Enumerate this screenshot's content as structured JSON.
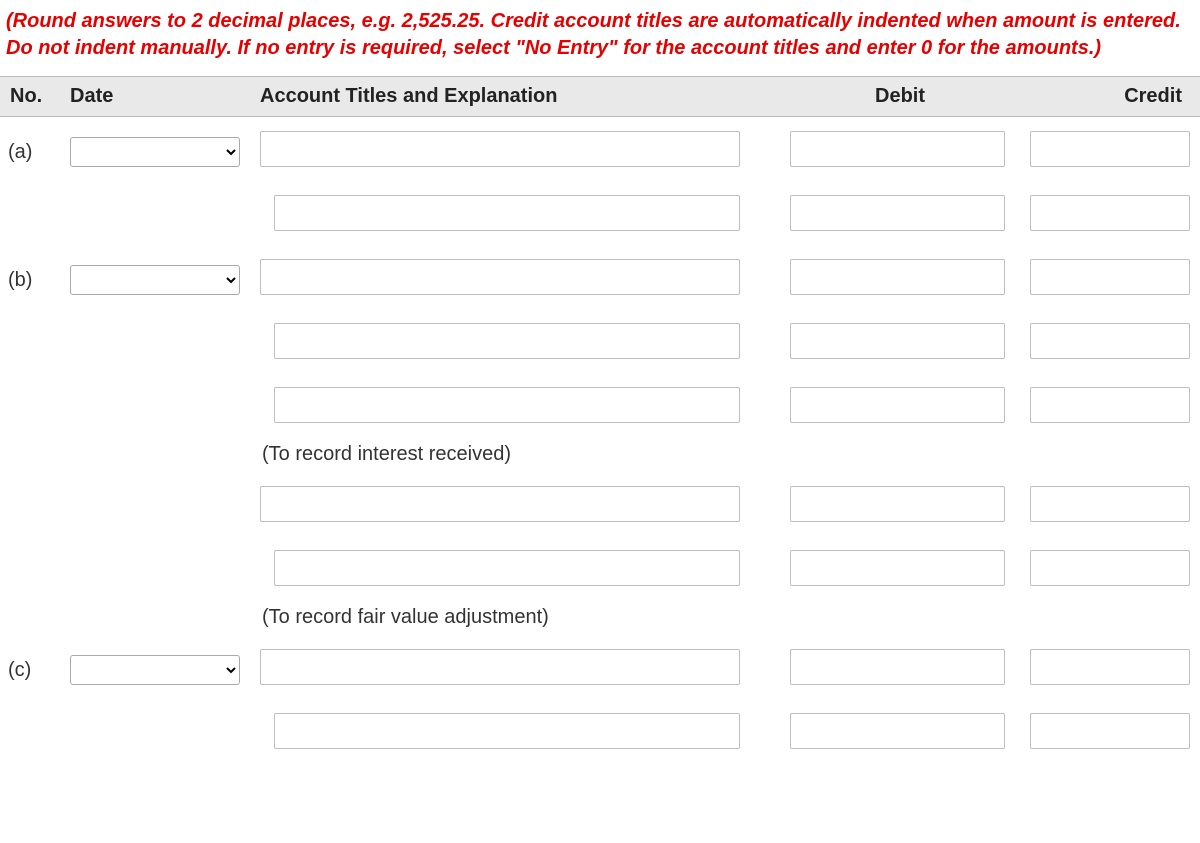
{
  "instructions": "(Round answers to 2 decimal places, e.g. 2,525.25. Credit account titles are automatically indented when amount is entered. Do not indent manually. If no entry is required, select \"No Entry\" for the account titles and enter 0 for the amounts.)",
  "headers": {
    "no": "No.",
    "date": "Date",
    "account": "Account Titles and Explanation",
    "debit": "Debit",
    "credit": "Credit"
  },
  "rows": {
    "a_label": "(a)",
    "b_label": "(b)",
    "c_label": "(c)",
    "explain_interest": "(To record interest received)",
    "explain_fair_value": "(To record fair value adjustment)"
  }
}
